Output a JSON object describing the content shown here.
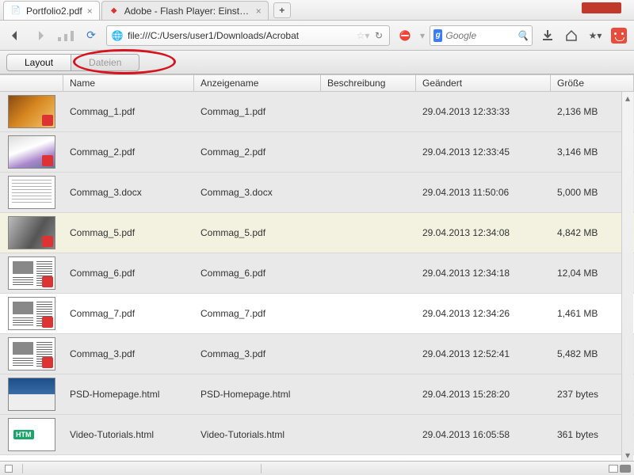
{
  "tabs": [
    {
      "label": "Portfolio2.pdf",
      "active": true
    },
    {
      "label": "Adobe - Flash Player: Einstellungsma…",
      "active": false
    }
  ],
  "url": "file:///C:/Users/user1/Downloads/Acrobat",
  "search_placeholder": "Google",
  "toolbar": {
    "layout": "Layout",
    "dateien": "Dateien"
  },
  "columns": {
    "name": "Name",
    "display": "Anzeigename",
    "desc": "Beschreibung",
    "date": "Geändert",
    "size": "Größe"
  },
  "rows": [
    {
      "name": "Commag_1.pdf",
      "display": "Commag_1.pdf",
      "desc": "",
      "date": "29.04.2013 12:33:33",
      "size": "2,136 MB",
      "thumb": "lion",
      "bg": ""
    },
    {
      "name": "Commag_2.pdf",
      "display": "Commag_2.pdf",
      "desc": "",
      "date": "29.04.2013 12:33:45",
      "size": "3,146 MB",
      "thumb": "photo",
      "bg": ""
    },
    {
      "name": "Commag_3.docx",
      "display": "Commag_3.docx",
      "desc": "",
      "date": "29.04.2013 11:50:06",
      "size": "5,000 MB",
      "thumb": "doc",
      "bg": ""
    },
    {
      "name": "Commag_5.pdf",
      "display": "Commag_5.pdf",
      "desc": "",
      "date": "29.04.2013 12:34:08",
      "size": "4,842 MB",
      "thumb": "gray",
      "bg": "sel"
    },
    {
      "name": "Commag_6.pdf",
      "display": "Commag_6.pdf",
      "desc": "",
      "date": "29.04.2013 12:34:18",
      "size": "12,04 MB",
      "thumb": "news",
      "bg": ""
    },
    {
      "name": "Commag_7.pdf",
      "display": "Commag_7.pdf",
      "desc": "",
      "date": "29.04.2013 12:34:26",
      "size": "1,461 MB",
      "thumb": "news",
      "bg": "white"
    },
    {
      "name": "Commag_3.pdf",
      "display": "Commag_3.pdf",
      "desc": "",
      "date": "29.04.2013 12:52:41",
      "size": "5,482 MB",
      "thumb": "news",
      "bg": ""
    },
    {
      "name": "PSD-Homepage.html",
      "display": "PSD-Homepage.html",
      "desc": "",
      "date": "29.04.2013 15:28:20",
      "size": "237 bytes",
      "thumb": "blue",
      "bg": ""
    },
    {
      "name": "Video-Tutorials.html",
      "display": "Video-Tutorials.html",
      "desc": "",
      "date": "29.04.2013 16:05:58",
      "size": "361 bytes",
      "thumb": "htm",
      "bg": ""
    }
  ]
}
